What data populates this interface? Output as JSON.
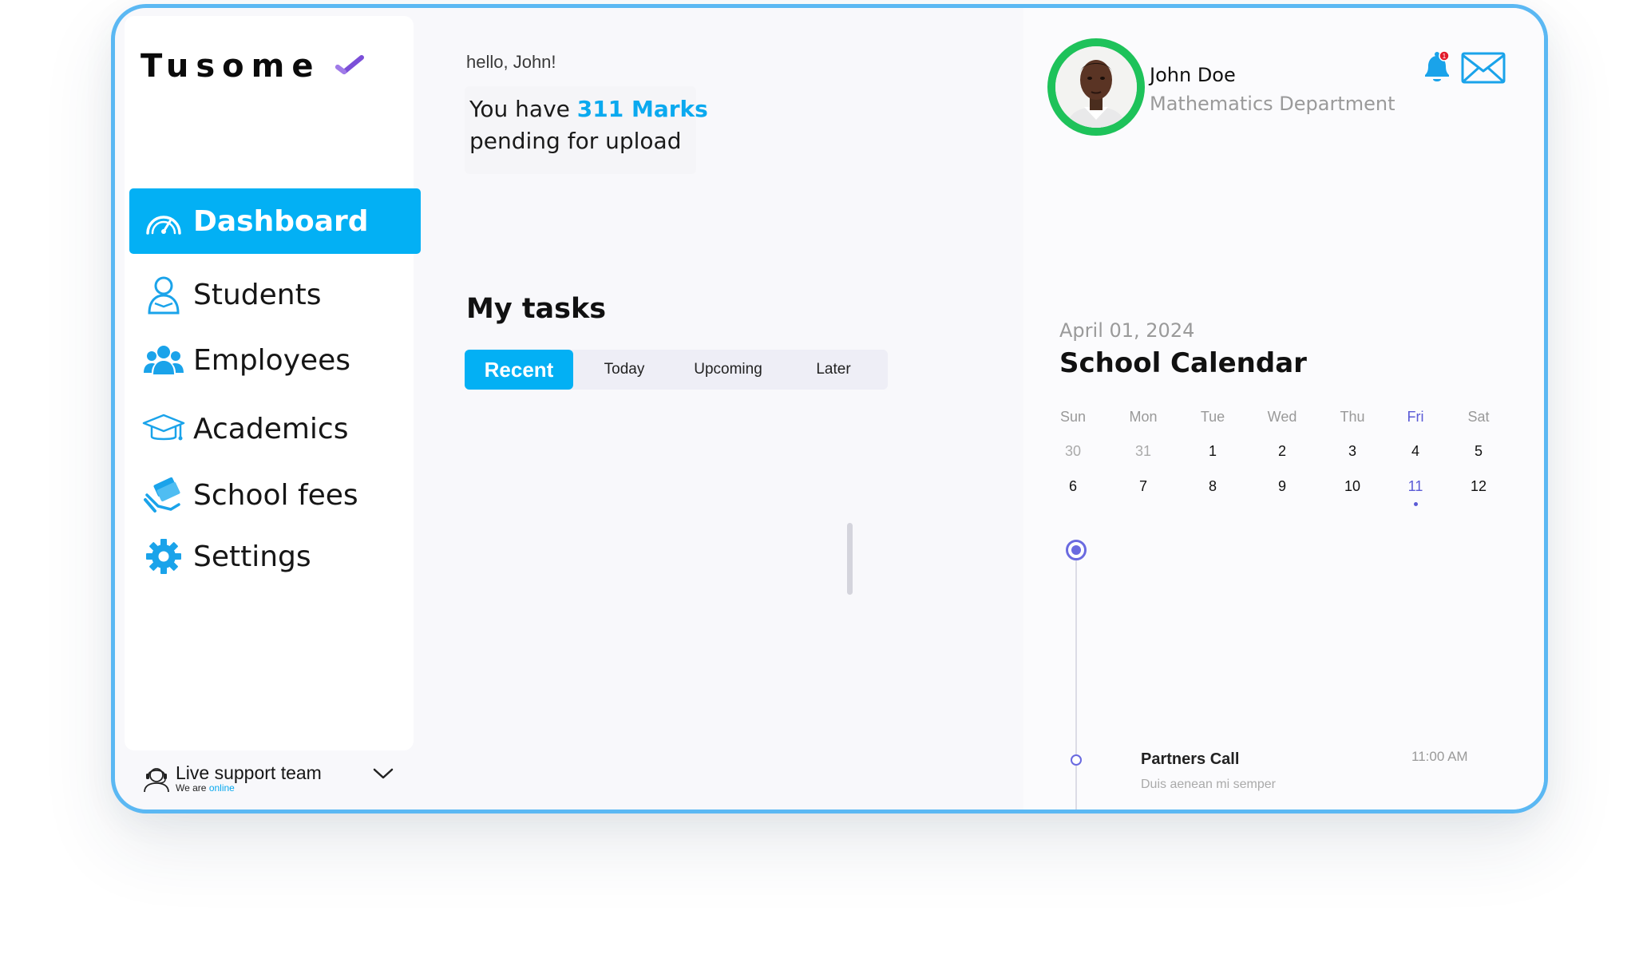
{
  "app": {
    "logo_text": "Tusome"
  },
  "sidebar": {
    "items": [
      {
        "label": "Dashboard",
        "icon": "dashboard-gauge-icon",
        "active": true
      },
      {
        "label": "Students",
        "icon": "student-icon",
        "active": false
      },
      {
        "label": "Employees",
        "icon": "employees-group-icon",
        "active": false
      },
      {
        "label": "Academics",
        "icon": "graduation-cap-icon",
        "active": false
      },
      {
        "label": "School fees",
        "icon": "money-hand-icon",
        "active": false
      },
      {
        "label": "Settings",
        "icon": "gear-icon",
        "active": false
      }
    ],
    "support": {
      "title": "Live support team",
      "status_prefix": "We are",
      "status_value": "online"
    }
  },
  "main": {
    "greeting": "hello, John!",
    "pending": {
      "prefix": "You have",
      "marks": "311 Marks",
      "suffix": "pending for upload"
    },
    "tasks_title": "My tasks",
    "tabs": [
      {
        "label": "Recent",
        "active": true
      },
      {
        "label": "Today",
        "active": false
      },
      {
        "label": "Upcoming",
        "active": false
      },
      {
        "label": "Later",
        "active": false
      }
    ]
  },
  "profile": {
    "name": "John Doe",
    "department": "Mathematics Department",
    "notification_count": "1"
  },
  "calendar": {
    "date": "April 01, 2024",
    "title": "School Calendar",
    "weekdays": [
      "Sun",
      "Mon",
      "Tue",
      "Wed",
      "Thu",
      "Fri",
      "Sat"
    ],
    "highlight_weekday": "Fri",
    "weeks": [
      [
        "30",
        "31",
        "1",
        "2",
        "3",
        "4",
        "5"
      ],
      [
        "6",
        "7",
        "8",
        "9",
        "10",
        "11",
        "12"
      ]
    ],
    "muted_days": [
      "30",
      "31"
    ],
    "selected_day": "11"
  },
  "events": [
    {
      "title": "Partners Call",
      "subtitle": "Duis aenean mi semper",
      "time": "11:00 AM"
    }
  ],
  "colors": {
    "accent": "#03b0f4",
    "frame_border": "#5bb8f3",
    "calendar_highlight": "#5b5bd6",
    "avatar_ring": "#1ec25a"
  }
}
